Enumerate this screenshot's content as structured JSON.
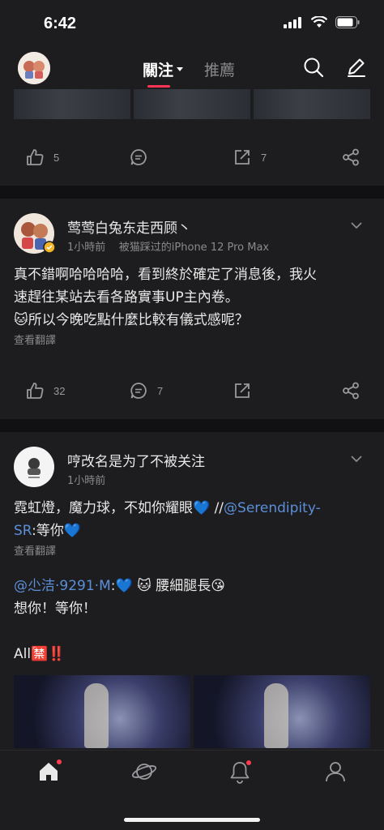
{
  "status": {
    "time": "6:42"
  },
  "nav": {
    "tab_follow": "關注",
    "tab_recommend": "推薦"
  },
  "post0": {
    "likes": "5",
    "reposts": "7"
  },
  "post1": {
    "name": "莺莺白兔东走西顾丶",
    "meta": "1小時前    被猫踩过的iPhone 12 Pro Max",
    "text_line1": "真不錯啊哈哈哈哈，看到終於確定了消息後，我火",
    "text_line2": "速趕往某站去看各路實事UP主內卷。",
    "text_line3": "所以今晚吃點什麼比較有儀式感呢？",
    "emoji": "🐱",
    "translate": "查看翻譯",
    "likes": "32",
    "comments": "7"
  },
  "post2": {
    "name": "哼改名是为了不被关注",
    "meta": "1小時前",
    "text_a": "霓虹燈，魔力球，不如你耀眼",
    "heart": "💙",
    "sep": " //",
    "mention1": "@Serendipity-",
    "mention1b": "SR",
    "text_b": ":等你",
    "translate": "查看翻譯",
    "mention2": "@尐洁·9291·M",
    "colon": ":",
    "cat": "🐱",
    "text_c": "腰細腿長",
    "kiss": "😘",
    "text_d": "想你！等你！",
    "text_e": "All",
    "banned": "🈲",
    "bang": "‼️"
  }
}
